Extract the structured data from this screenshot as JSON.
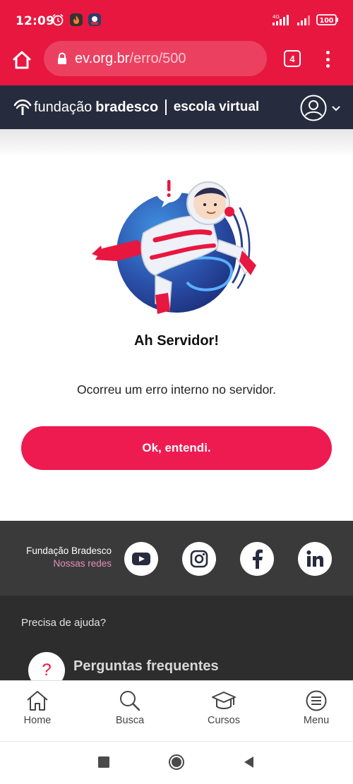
{
  "status_bar": {
    "time": "12:09",
    "network": "4G",
    "battery": "100"
  },
  "browser": {
    "url_domain": "ev.org.br",
    "url_path": "/erro/500",
    "tab_count": "4"
  },
  "header": {
    "brand_primary": "fundação",
    "brand_bold": "bradesco",
    "brand_secondary": "escola virtual"
  },
  "error": {
    "title": "Ah Servidor!",
    "message": "Ocorreu um erro interno no servidor.",
    "button_label": "Ok, entendi."
  },
  "footer": {
    "brand": "Fundação Bradesco",
    "social_label": "Nossas redes",
    "social": [
      "youtube-icon",
      "instagram-icon",
      "facebook-icon",
      "linkedin-icon"
    ],
    "help_label": "Precisa de ajuda?",
    "faq_label": "Perguntas frequentes"
  },
  "bottom_nav": {
    "items": [
      {
        "label": "Home",
        "icon": "home-icon"
      },
      {
        "label": "Busca",
        "icon": "search-icon"
      },
      {
        "label": "Cursos",
        "icon": "graduation-cap-icon"
      },
      {
        "label": "Menu",
        "icon": "menu-icon"
      }
    ]
  },
  "colors": {
    "brand_red": "#e8173f",
    "button_pink": "#ee1b51",
    "header_navy": "#262c3d",
    "footer_dark": "#3a3a3a"
  }
}
